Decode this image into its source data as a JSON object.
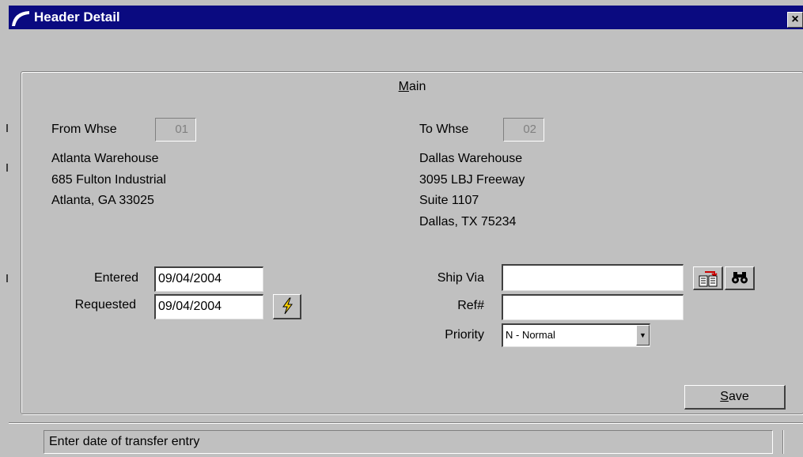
{
  "window": {
    "title": "Header Detail",
    "close_glyph": "×"
  },
  "panel": {
    "title_first": "M",
    "title_rest": "ain"
  },
  "from": {
    "label": "From Whse",
    "value": "01",
    "address": [
      "Atlanta Warehouse",
      "685 Fulton Industrial",
      "Atlanta, GA 33025"
    ]
  },
  "to": {
    "label": "To Whse",
    "value": "02",
    "address": [
      "Dallas Warehouse",
      "3095 LBJ Freeway",
      "Suite 1107",
      "Dallas, TX 75234"
    ]
  },
  "dates": {
    "entered_label": "Entered",
    "entered_value": "09/04/2004",
    "requested_label": "Requested",
    "requested_value": "09/04/2004"
  },
  "shipping": {
    "ship_via_label": "Ship Via",
    "ship_via_value": "",
    "ref_label": "Ref#",
    "ref_value": "",
    "priority_label": "Priority",
    "priority_value": "N - Normal"
  },
  "buttons": {
    "save_first": "S",
    "save_rest": "ave"
  },
  "status": {
    "message": "Enter date of transfer entry"
  },
  "colors": {
    "titlebar": "#0a0a80",
    "window_bg": "#c0c0c0",
    "lightning": "#ffd400",
    "lookup_red": "#cc0000"
  },
  "icons": {
    "app": "app-icon",
    "close": "close-icon",
    "date_action": "lightning-icon",
    "ship_via_list": "list-lookup-icon",
    "ship_via_search": "binoculars-icon",
    "dropdown": "chevron-down-icon"
  }
}
